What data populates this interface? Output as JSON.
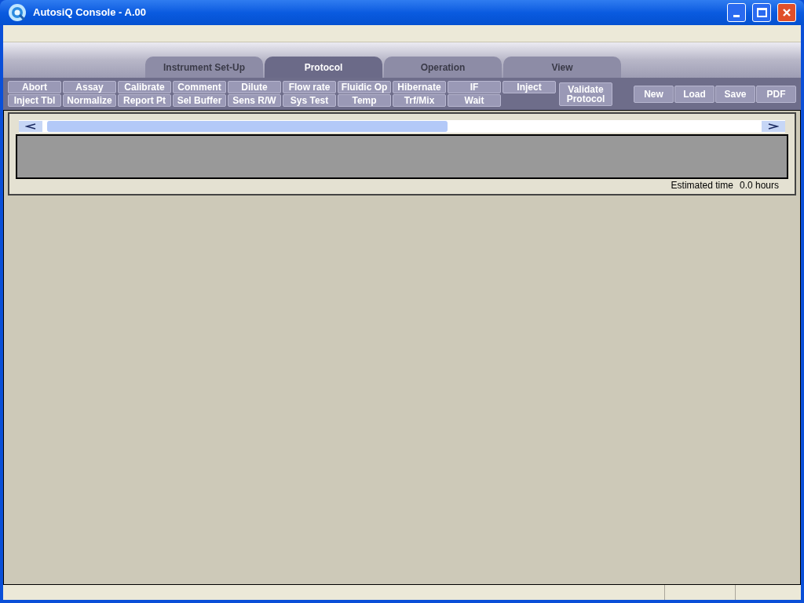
{
  "window": {
    "title": "AutosiQ Console - A.00"
  },
  "tabs": [
    {
      "label": "Instrument Set-Up",
      "selected": false
    },
    {
      "label": "Protocol",
      "selected": true
    },
    {
      "label": "Operation",
      "selected": false
    },
    {
      "label": "View",
      "selected": false
    }
  ],
  "commands": [
    "Abort",
    "Assay",
    "Calibrate",
    "Comment",
    "Dilute",
    "Flow rate",
    "Fluidic Op",
    "Hibernate",
    "IF",
    "Inject",
    "Inject Tbl",
    "Normalize",
    "Report Pt",
    "Sel Buffer",
    "Sens R/W",
    "Sys Test",
    "Temp",
    "Trf/Mix",
    "Wait"
  ],
  "validate_button": [
    "Validate",
    "Protocol"
  ],
  "file_buttons": [
    "New",
    "Load",
    "Save",
    "PDF"
  ],
  "protocol_panel": {
    "estimated_time_label": "Estimated time",
    "estimated_time_value": "0.0 hours"
  }
}
